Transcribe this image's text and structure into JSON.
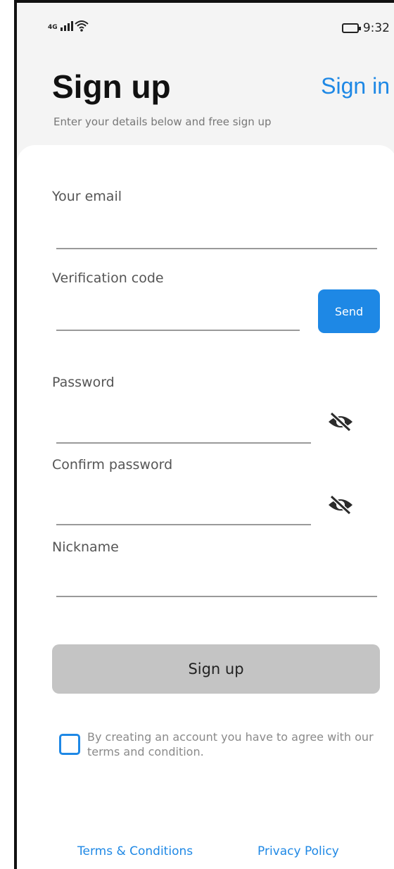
{
  "status_bar": {
    "signal_text": "4G",
    "time": "9:32"
  },
  "header": {
    "title": "Sign up",
    "signin_link": "Sign in",
    "subtitle": "Enter your details below and free sign up"
  },
  "form": {
    "email_label": "Your email",
    "email_value": "",
    "code_label": "Verification code",
    "code_value": "",
    "send_label": "Send",
    "password_label": "Password",
    "password_value": "",
    "confirm_label": "Confirm password",
    "confirm_value": "",
    "nickname_label": "Nickname",
    "nickname_value": "",
    "submit_label": "Sign up",
    "submit_enabled": false
  },
  "agreement": {
    "checked": false,
    "text": "By creating an account you have to agree with our terms and condition."
  },
  "footer": {
    "terms_label": "Terms & Conditions",
    "privacy_label": "Privacy Policy"
  },
  "colors": {
    "accent": "#1e88e5",
    "disabled_button": "#c4c4c4",
    "background": "#f4f4f4",
    "card": "#ffffff"
  },
  "icons": {
    "signal": "signal-icon",
    "wifi": "wifi-icon",
    "battery": "battery-icon",
    "password_toggle": "eye-off-icon"
  }
}
